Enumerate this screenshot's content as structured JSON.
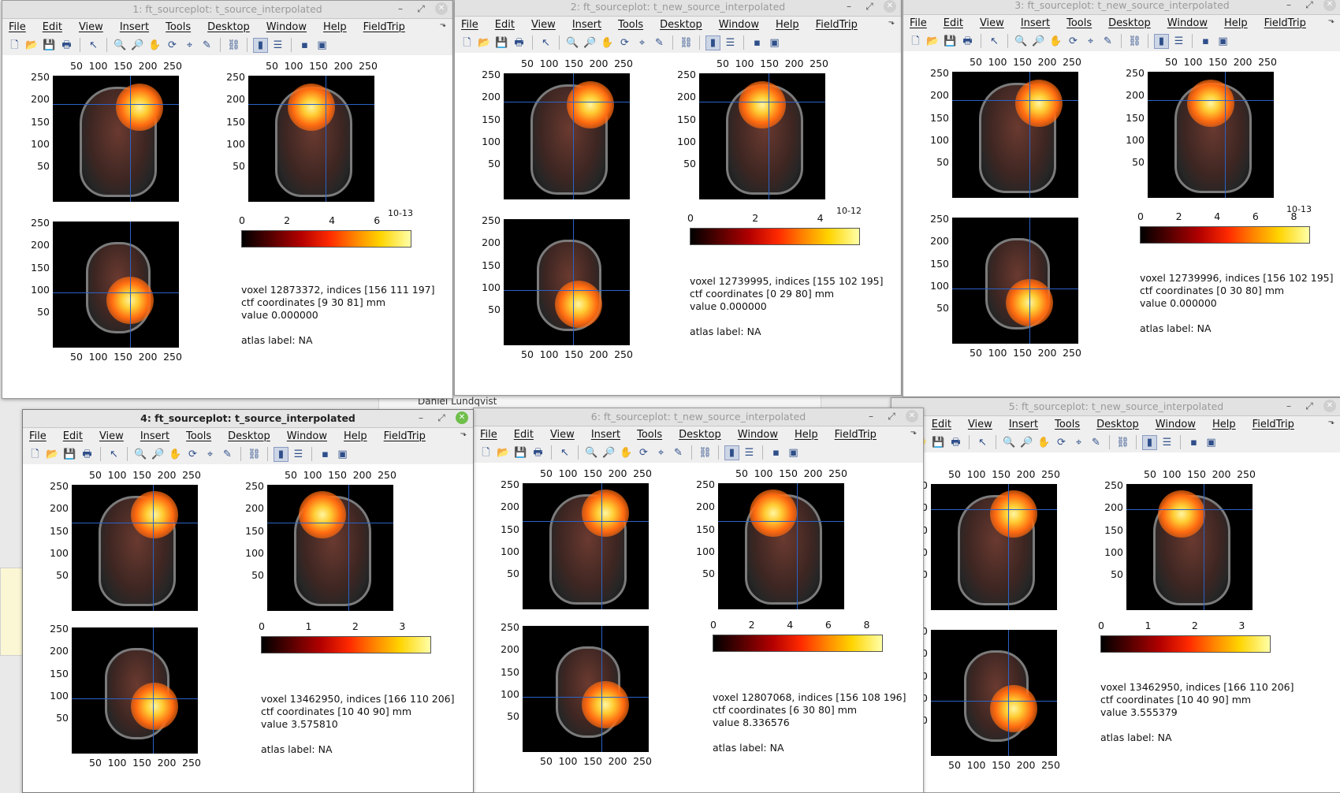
{
  "background": {
    "text": "Daniel Lundqvist"
  },
  "menu": [
    "File",
    "Edit",
    "View",
    "Insert",
    "Tools",
    "Desktop",
    "Window",
    "Help",
    "FieldTrip"
  ],
  "ticks": {
    "x": [
      "50",
      "100",
      "150",
      "200",
      "250"
    ],
    "y": [
      "250",
      "200",
      "150",
      "100",
      "50"
    ]
  },
  "windows": [
    {
      "title": "1: ft_sourceplot: t_source_interpolated",
      "cbar_ticks": [
        "0",
        "2",
        "4",
        "6"
      ],
      "cbar_exp": "10-13",
      "voxel": "voxel 12873372, indices [156 111 197]",
      "ctf": "ctf coordinates [9 30 81] mm",
      "value": "value 0.000000",
      "atlas": "atlas label: NA"
    },
    {
      "title": "2: ft_sourceplot: t_new_source_interpolated",
      "cbar_ticks": [
        "0",
        "2",
        "4"
      ],
      "cbar_exp": "10-12",
      "voxel": "voxel 12739995, indices [155 102 195]",
      "ctf": "ctf coordinates [0 29 80] mm",
      "value": "value 0.000000",
      "atlas": "atlas label: NA"
    },
    {
      "title": "3: ft_sourceplot: t_new_source_interpolated",
      "cbar_ticks": [
        "0",
        "2",
        "4",
        "6",
        "8"
      ],
      "cbar_exp": "10-13",
      "voxel": "voxel 12739996, indices [156 102 195]",
      "ctf": "ctf coordinates [0 30 80] mm",
      "value": "value 0.000000",
      "atlas": "atlas label: NA"
    },
    {
      "title": "4: ft_sourceplot: t_source_interpolated",
      "cbar_ticks": [
        "0",
        "1",
        "2",
        "3"
      ],
      "cbar_exp": "",
      "voxel": "voxel 13462950, indices [166 110 206]",
      "ctf": "ctf coordinates [10 40 90] mm",
      "value": "value 3.575810",
      "atlas": "atlas label: NA"
    },
    {
      "title": "6: ft_sourceplot: t_new_source_interpolated",
      "cbar_ticks": [
        "0",
        "2",
        "4",
        "6",
        "8"
      ],
      "cbar_exp": "",
      "voxel": "voxel 12807068, indices [156 108 196]",
      "ctf": "ctf coordinates [6 30 80] mm",
      "value": "value 8.336576",
      "atlas": "atlas label: NA"
    },
    {
      "title": "5: ft_sourceplot: t_new_source_interpolated",
      "cbar_ticks": [
        "0",
        "1",
        "2",
        "3"
      ],
      "cbar_exp": "",
      "voxel": "voxel 13462950, indices [166 110 206]",
      "ctf": "ctf coordinates [10 40 90] mm",
      "value": "value 3.555379",
      "atlas": "atlas label: NA"
    }
  ],
  "icons": [
    "new-file-icon",
    "open-folder-icon",
    "save-icon",
    "print-icon",
    "pointer-icon",
    "zoom-in-icon",
    "zoom-out-icon",
    "pan-icon",
    "rotate-icon",
    "data-cursor-icon",
    "brush-icon",
    "link-icon",
    "colorbar-icon",
    "legend-icon",
    "hide-plot-tools-icon",
    "show-plot-tools-icon"
  ],
  "colors": {
    "crosshair": "#2b62c7",
    "active_close": "#6fbf4a"
  }
}
